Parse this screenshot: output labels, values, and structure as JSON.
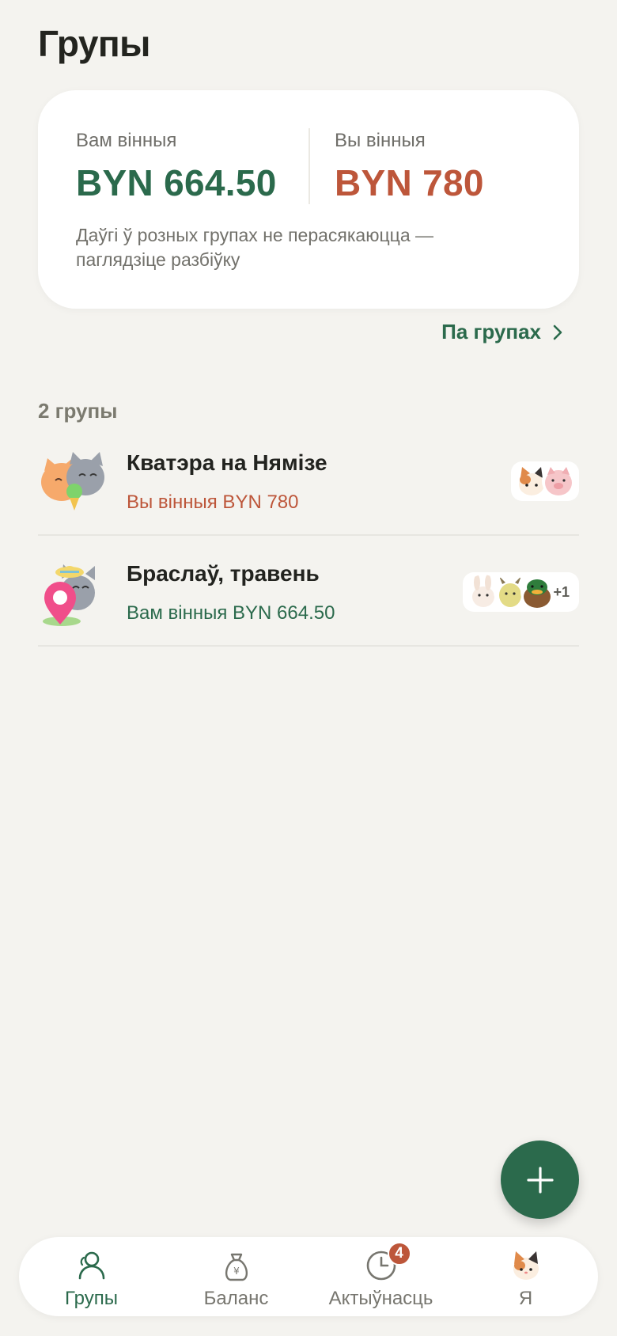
{
  "header": {
    "title": "Групы"
  },
  "summary": {
    "owed_label": "Вам вінныя",
    "owed_value": "BYN 664.50",
    "owe_label": "Вы вінныя",
    "owe_value": "BYN 780",
    "note": "Даўгі ў розных групах не перасякаюцца — паглядзіце разбіўку"
  },
  "by_groups_link": "Па групах",
  "groups_count": "2 групы",
  "groups": [
    {
      "name": "Кватэра на Нямізе",
      "balance": "Вы вінныя BYN 780",
      "status": "owe"
    },
    {
      "name": "Браслаў, травень",
      "balance": "Вам вінныя BYN 664.50",
      "status": "owed",
      "extra_members": "+1"
    }
  ],
  "nav": {
    "items": [
      {
        "label": "Групы",
        "icon": "people-icon",
        "active": true
      },
      {
        "label": "Баланс",
        "icon": "money-bag-icon"
      },
      {
        "label": "Актыўнасць",
        "icon": "clock-icon",
        "badge": "4"
      },
      {
        "label": "Я",
        "icon": "cat-avatar-icon"
      }
    ]
  },
  "colors": {
    "accent": "#2b6a4c",
    "negative": "#bd563a",
    "background": "#f4f3ef"
  }
}
